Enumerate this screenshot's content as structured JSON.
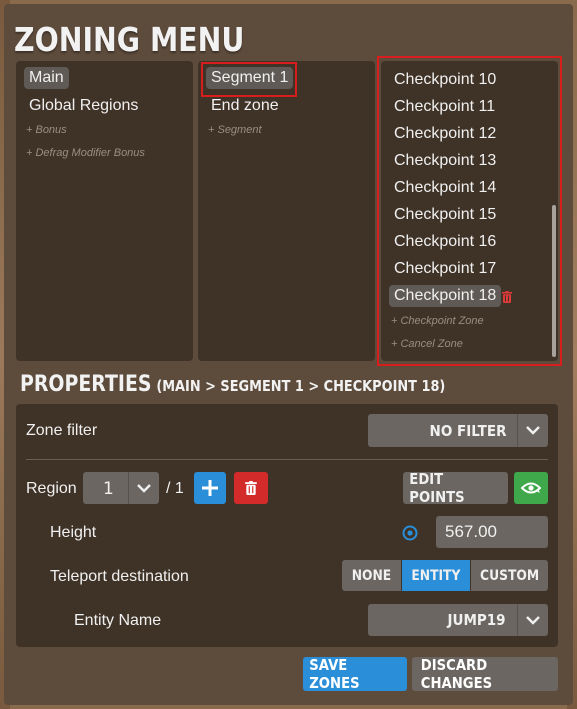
{
  "title": "ZONING MENU",
  "columns": {
    "col1": {
      "items": [
        {
          "label": "Main",
          "selected": true
        },
        {
          "label": "Global Regions",
          "selected": false
        }
      ],
      "adds": [
        "+ Bonus",
        "+ Defrag Modifier Bonus"
      ]
    },
    "col2": {
      "items": [
        {
          "label": "Segment 1",
          "selected": true
        },
        {
          "label": "End zone",
          "selected": false
        }
      ],
      "adds": [
        "+ Segment"
      ]
    },
    "col3": {
      "items": [
        {
          "label": "Checkpoint 10"
        },
        {
          "label": "Checkpoint 11"
        },
        {
          "label": "Checkpoint 12"
        },
        {
          "label": "Checkpoint 13"
        },
        {
          "label": "Checkpoint 14"
        },
        {
          "label": "Checkpoint 15"
        },
        {
          "label": "Checkpoint 16"
        },
        {
          "label": "Checkpoint 17"
        },
        {
          "label": "Checkpoint 18",
          "selected": true
        }
      ],
      "adds": [
        "+ Checkpoint Zone",
        "+ Cancel Zone"
      ]
    }
  },
  "properties": {
    "title": "PROPERTIES",
    "path": "(MAIN > SEGMENT 1 > CHECKPOINT 18)",
    "zone_filter_label": "Zone filter",
    "zone_filter_value": "NO FILTER",
    "region_label": "Region",
    "region_value": "1",
    "region_total": "/ 1",
    "edit_points_label": "EDIT POINTS",
    "height_label": "Height",
    "height_value": "567.00",
    "teleport_label": "Teleport destination",
    "teleport_options": [
      "NONE",
      "ENTITY",
      "CUSTOM"
    ],
    "teleport_selected": "ENTITY",
    "entity_name_label": "Entity Name",
    "entity_name_value": "JUMP19"
  },
  "footer": {
    "save_label": "SAVE ZONES",
    "discard_label": "DISCARD CHANGES"
  },
  "colors": {
    "accent_blue": "#2a8ed8",
    "danger_red": "#d32a2a",
    "success_green": "#3ea84a",
    "highlight_box": "#d81d1d"
  },
  "icons": {
    "add": "plus-icon",
    "delete": "trash-icon",
    "toggle_visibility": "eye-refresh-icon",
    "dropdown": "chevron-down-icon",
    "height_picker": "target-icon"
  }
}
